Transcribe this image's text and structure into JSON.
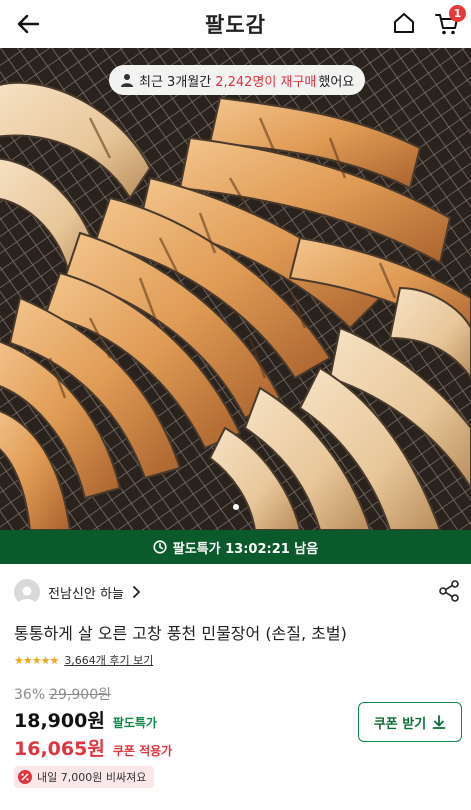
{
  "header": {
    "title": "팔도감",
    "cart_count": "1",
    "icons": [
      "back-arrow-icon",
      "home-icon",
      "cart-icon"
    ]
  },
  "hero": {
    "repurchase": {
      "prefix": "최근 3개월간",
      "highlight": "2,242명이 재구매",
      "suffix": "했어요"
    },
    "slide_count": 1,
    "active_slide": 1
  },
  "deal_bar": {
    "text": "팔도특가 13:02:21 남음"
  },
  "seller": {
    "name": "전남신안 하늘"
  },
  "product": {
    "title": "통통하게 살 오른 고창 풍천 민물장어 (손질, 초벌)",
    "rating_stars": 5,
    "reviews_text": "3,664개 후기 보기"
  },
  "pricing": {
    "discount_rate": "36%",
    "original_price": "29,900원",
    "sale_price": "18,900원",
    "sale_tag": "팔도특가",
    "coupon_price": "16,065원",
    "coupon_tag": "쿠폰 적용가",
    "coupon_button_label": "쿠폰 받기"
  },
  "notice": {
    "text": "내일 7,000원 비싸져요"
  },
  "colors": {
    "deal_bar_bg": "#0b5a2c",
    "accent_green": "#0c8a43",
    "accent_red": "#e0343f",
    "star": "#f2a41c"
  }
}
